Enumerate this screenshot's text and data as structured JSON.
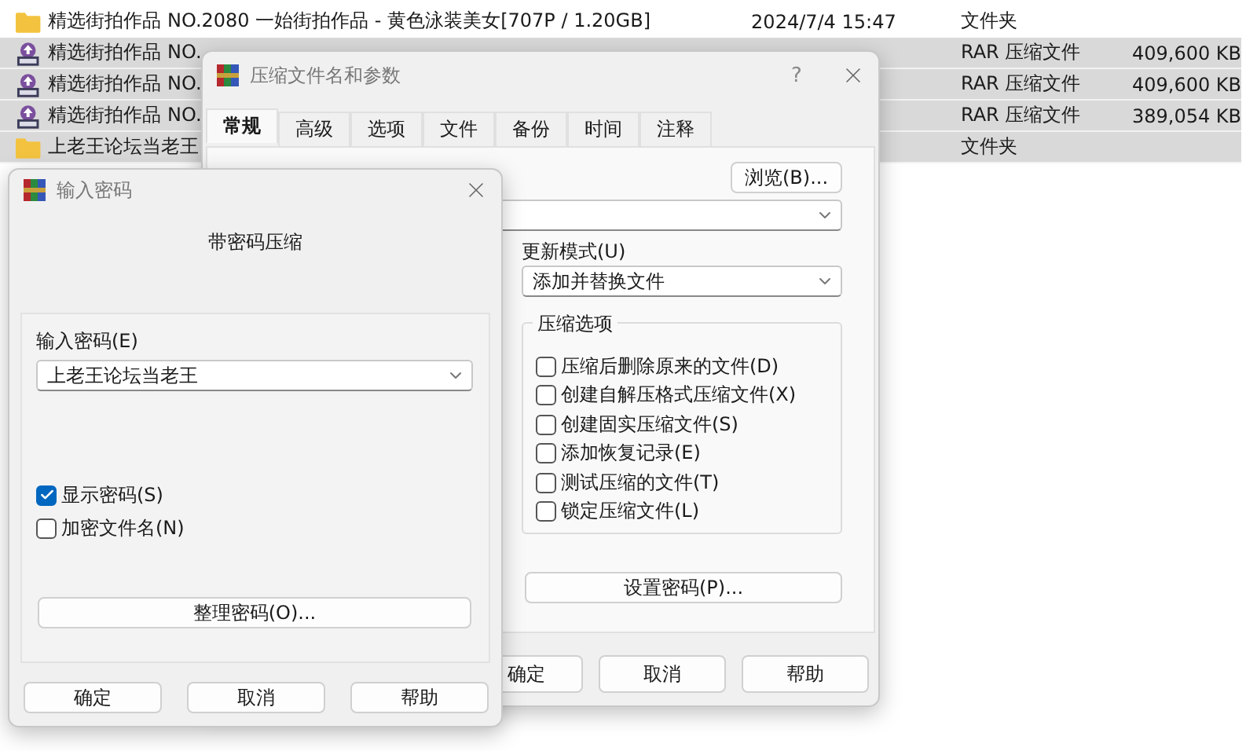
{
  "file_list": {
    "rows": [
      {
        "kind": "folder",
        "name": "精选街拍作品 NO.2080 一始街拍作品 - 黄色泳装美女[707P / 1.20GB]",
        "date": "2024/7/4 15:47",
        "type": "文件夹",
        "selected": false
      },
      {
        "kind": "archive",
        "name": "精选街拍作品 NO.",
        "type": "RAR 压缩文件",
        "size": "409,600 KB",
        "selected": true
      },
      {
        "kind": "archive",
        "name": "精选街拍作品 NO.",
        "type": "RAR 压缩文件",
        "size": "409,600 KB",
        "selected": true
      },
      {
        "kind": "archive",
        "name": "精选街拍作品 NO.",
        "type": "RAR 压缩文件",
        "size": "389,054 KB",
        "selected": true
      },
      {
        "kind": "folder",
        "name": "上老王论坛当老王",
        "type": "文件夹",
        "selected": true
      }
    ]
  },
  "compress_dialog": {
    "title": "压缩文件名和参数",
    "help_glyph": "?",
    "tabs": [
      {
        "label": "常规",
        "selected": true
      },
      {
        "label": "高级",
        "selected": false
      },
      {
        "label": "选项",
        "selected": false
      },
      {
        "label": "文件",
        "selected": false
      },
      {
        "label": "备份",
        "selected": false
      },
      {
        "label": "时间",
        "selected": false
      },
      {
        "label": "注释",
        "selected": false
      }
    ],
    "browse_button": "浏览(B)...",
    "update_mode_label": "更新模式(U)",
    "update_mode_value": "添加并替换文件",
    "options_group": {
      "title": "压缩选项",
      "options": [
        {
          "label": "压缩后删除原来的文件(D)",
          "checked": false
        },
        {
          "label": "创建自解压格式压缩文件(X)",
          "checked": false
        },
        {
          "label": "创建固实压缩文件(S)",
          "checked": false
        },
        {
          "label": "添加恢复记录(E)",
          "checked": false
        },
        {
          "label": "测试压缩的文件(T)",
          "checked": false
        },
        {
          "label": "锁定压缩文件(L)",
          "checked": false
        }
      ]
    },
    "set_password_button": "设置密码(P)...",
    "buttons": [
      "确定",
      "取消",
      "帮助"
    ]
  },
  "password_dialog": {
    "title": "输入密码",
    "heading": "带密码压缩",
    "password_label": "输入密码(E)",
    "password_value": "上老王论坛当老王",
    "options": [
      {
        "label": "显示密码(S)",
        "checked": true
      },
      {
        "label": "加密文件名(N)",
        "checked": false
      }
    ],
    "organize_button": "整理密码(O)...",
    "buttons": [
      "确定",
      "取消",
      "帮助"
    ]
  }
}
